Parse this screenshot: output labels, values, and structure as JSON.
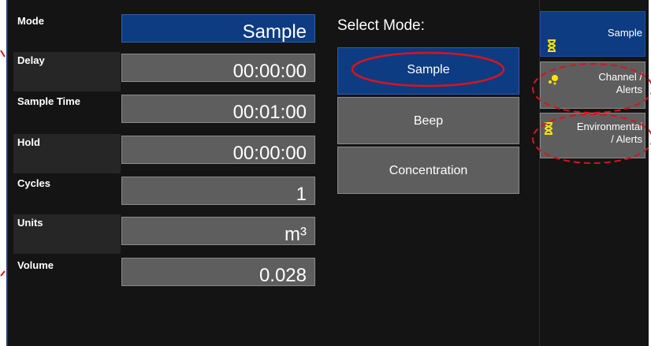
{
  "fields": [
    {
      "label": "Mode",
      "value": "Sample"
    },
    {
      "label": "Delay",
      "value": "00:00:00"
    },
    {
      "label": "Sample Time",
      "value": "00:01:00"
    },
    {
      "label": "Hold",
      "value": "00:00:00"
    },
    {
      "label": "Cycles",
      "value": "1"
    },
    {
      "label": "Units",
      "value": "m³"
    },
    {
      "label": "Volume",
      "value": "0.028"
    }
  ],
  "select_mode": {
    "title": "Select Mode:",
    "options": [
      "Sample",
      "Beep",
      "Concentration"
    ],
    "selected": "Sample"
  },
  "side_tabs": [
    {
      "label": "Sample",
      "icon": "hourglass-icon",
      "active": true
    },
    {
      "label_line1": "Channel /",
      "label_line2": "Alerts",
      "icon": "dots-icon",
      "active": false
    },
    {
      "label_line1": "Environmental",
      "label_line2": "/ Alerts",
      "icon": "hourglass-icon",
      "active": false
    }
  ],
  "colors": {
    "background": "#141414",
    "active_blue": "#0d3c83",
    "button_gray": "#5e5e5e",
    "icon_yellow": "#ffe400",
    "annotation_red": "#d8141c"
  }
}
